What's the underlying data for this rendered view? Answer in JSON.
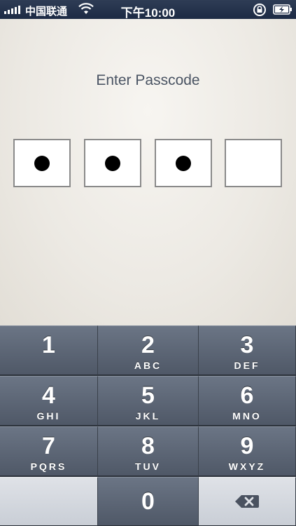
{
  "status_bar": {
    "carrier": "中国联通",
    "time": "下午10:00"
  },
  "passcode": {
    "prompt": "Enter Passcode",
    "entered_digits": 3,
    "total_digits": 4
  },
  "keypad": {
    "keys": [
      {
        "num": "1",
        "letters": ""
      },
      {
        "num": "2",
        "letters": "ABC"
      },
      {
        "num": "3",
        "letters": "DEF"
      },
      {
        "num": "4",
        "letters": "GHI"
      },
      {
        "num": "5",
        "letters": "JKL"
      },
      {
        "num": "6",
        "letters": "MNO"
      },
      {
        "num": "7",
        "letters": "PQRS"
      },
      {
        "num": "8",
        "letters": "TUV"
      },
      {
        "num": "9",
        "letters": "WXYZ"
      },
      {
        "num": "0",
        "letters": ""
      }
    ]
  },
  "icons": {
    "signal": "cellular-signal-icon",
    "wifi": "wifi-icon",
    "rotation_lock": "rotation-lock-icon",
    "battery": "battery-charging-icon",
    "delete": "backspace-icon"
  }
}
